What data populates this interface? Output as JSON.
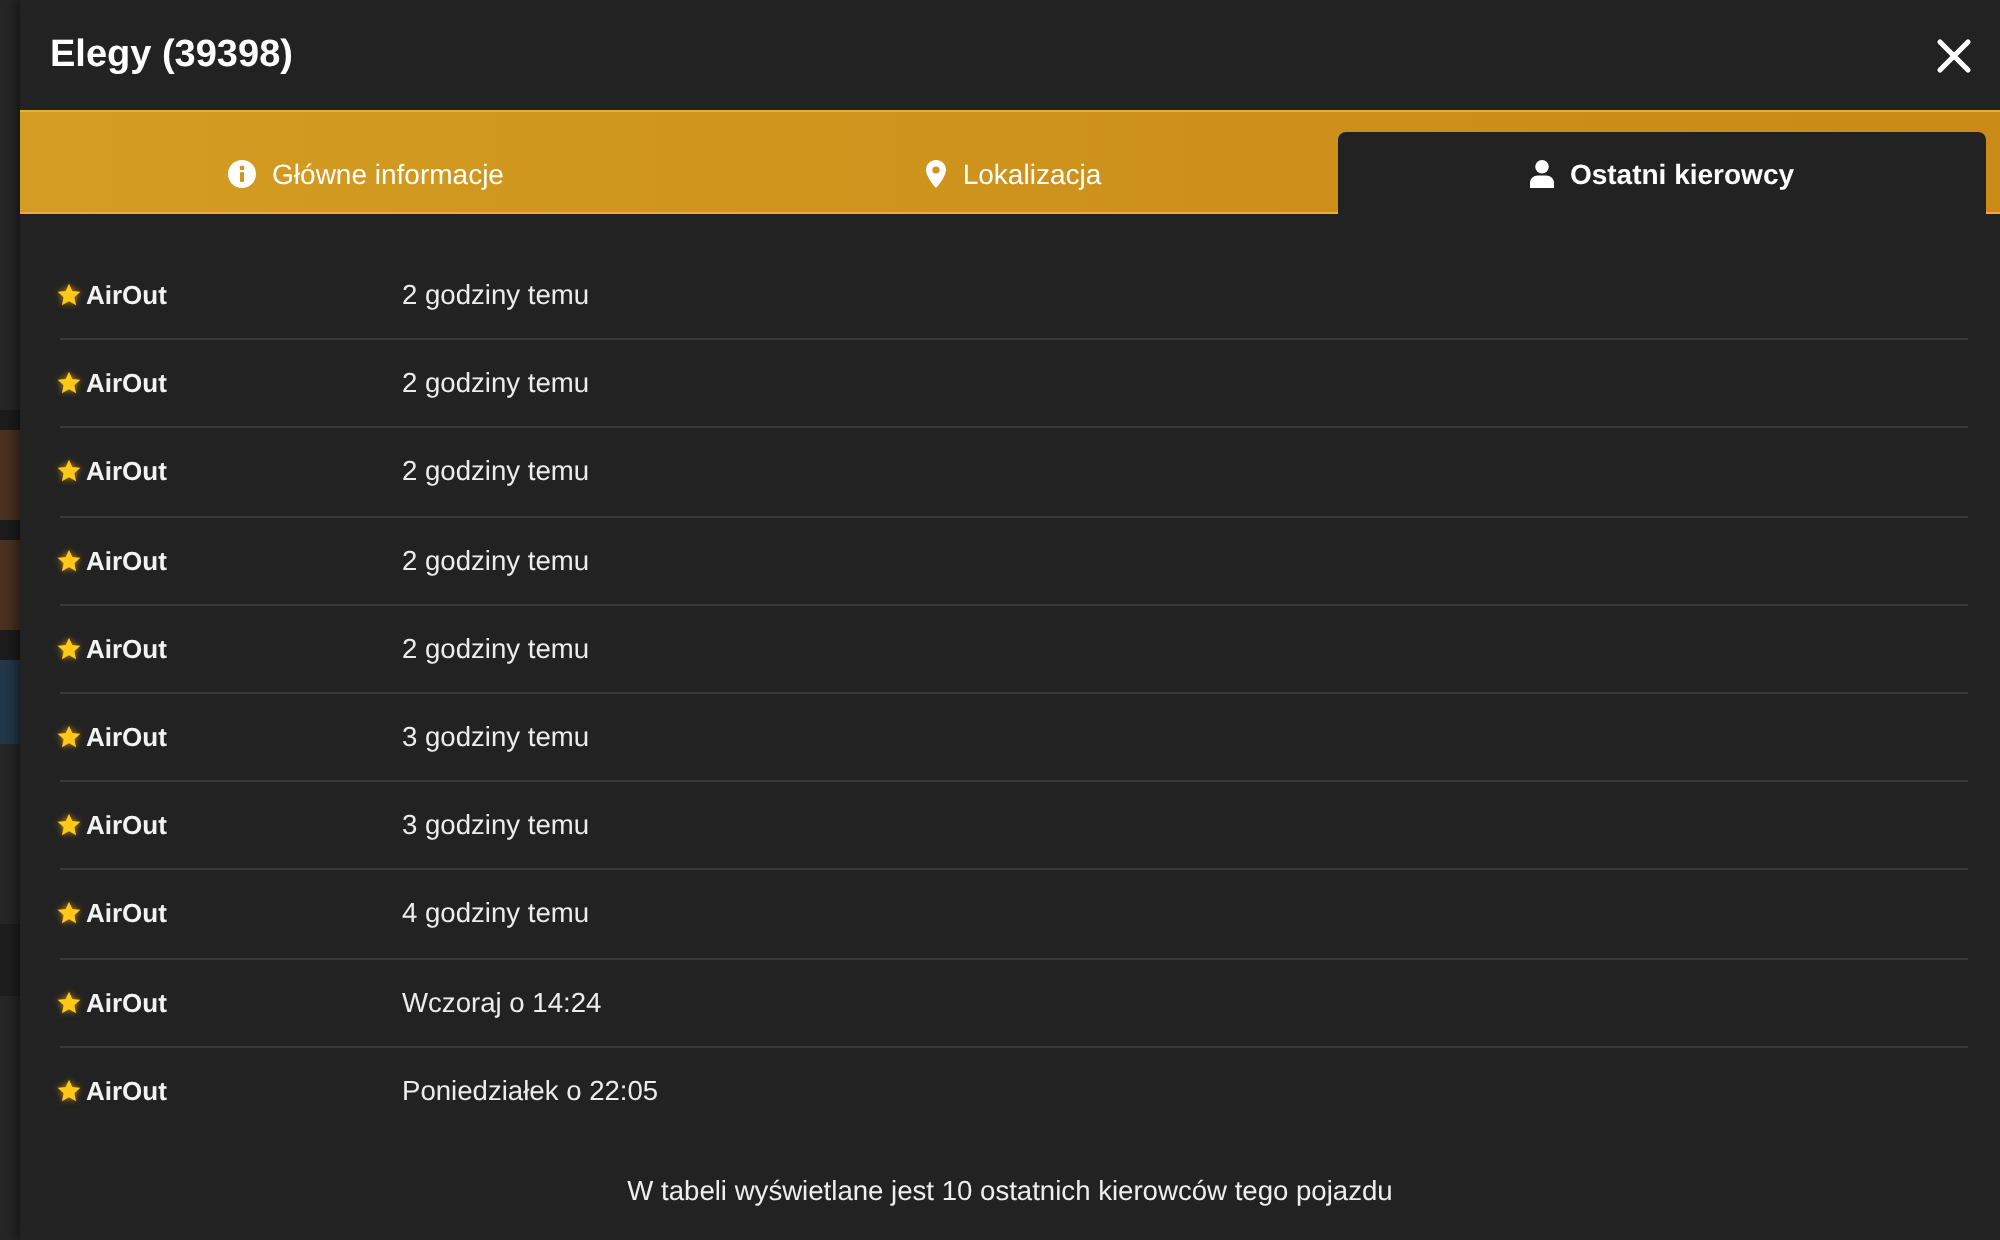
{
  "dialog": {
    "title": "Elegy (39398)"
  },
  "tabs": [
    {
      "label": "Główne informacje",
      "selected": false
    },
    {
      "label": "Lokalizacja",
      "selected": false
    },
    {
      "label": "Ostatni kierowcy",
      "selected": true
    }
  ],
  "drivers": [
    {
      "name": "AirOut",
      "time": "2 godziny temu"
    },
    {
      "name": "AirOut",
      "time": "2 godziny temu"
    },
    {
      "name": "AirOut",
      "time": "2 godziny temu"
    },
    {
      "name": "AirOut",
      "time": "2 godziny temu"
    },
    {
      "name": "AirOut",
      "time": "2 godziny temu"
    },
    {
      "name": "AirOut",
      "time": "3 godziny temu"
    },
    {
      "name": "AirOut",
      "time": "3 godziny temu"
    },
    {
      "name": "AirOut",
      "time": "4 godziny temu"
    },
    {
      "name": "AirOut",
      "time": "Wczoraj o 14:24"
    },
    {
      "name": "AirOut",
      "time": "Poniedziałek o 22:05"
    }
  ],
  "footer_note": "W tabeli wyświetlane jest 10 ostatnich kierowców tego pojazdu"
}
